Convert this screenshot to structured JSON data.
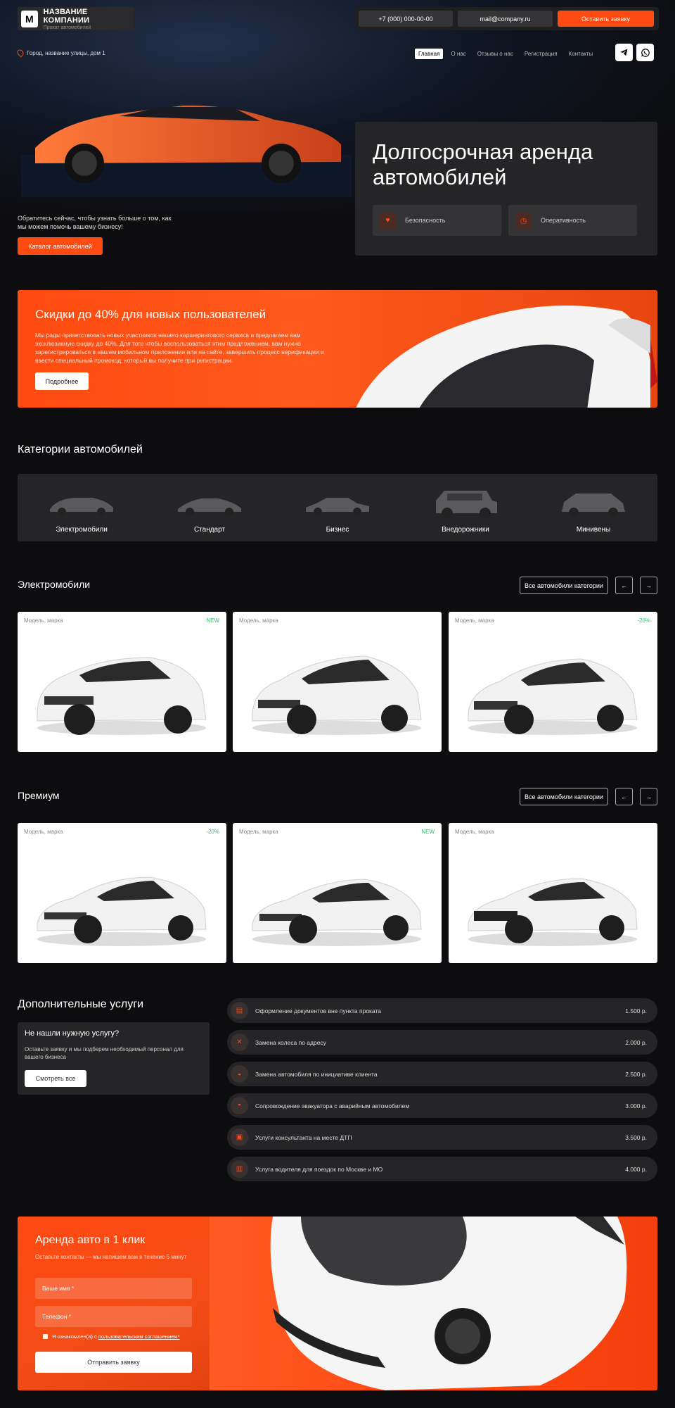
{
  "header": {
    "logo_icon": "M",
    "company_name": "НАЗВАНИЕ КОМПАНИИ",
    "company_sub": "Прокат автомобилей",
    "phone": "+7 (000) 000-00-00",
    "email": "mail@company.ru",
    "order_button": "Оставить заявку",
    "address": "Город, название улицы, дом 1",
    "nav": [
      "Главная",
      "О нас",
      "Отзывы о нас",
      "Регистрация",
      "Контакты"
    ],
    "socials": [
      "telegram-icon",
      "whatsapp-icon"
    ]
  },
  "hero": {
    "intro": "Обратитесь сейчас, чтобы узнать больше о том, как мы можем помочь вашему бизнесу!",
    "catalog_button": "Каталог автомобилей",
    "title": "Долгосрочная аренда автомобилей",
    "features": [
      {
        "icon": "heart-shield-icon",
        "label": "Безопасность"
      },
      {
        "icon": "clock-icon",
        "label": "Оперативность"
      }
    ]
  },
  "promo": {
    "title": "Скидки до 40% для новых пользователей",
    "text": "Мы рады приветствовать новых участников нашего каршерингового сервиса и предлагаем вам эксклюзивную скидку до 40%. Для того чтобы воспользоваться этим предложением, вам нужно зарегистрироваться в нашем мобильном приложении или на сайте, завершить процесс верификации и ввести специальный промокод, который вы получите при регистрации.",
    "button": "Подробнее"
  },
  "categories": {
    "title": "Категории автомобилей",
    "items": [
      "Электромобили",
      "Стандарт",
      "Бизнес",
      "Внедорожники",
      "Минивены"
    ]
  },
  "sliders": [
    {
      "title": "Электромобили",
      "all_button": "Все автомобили категории",
      "prev": "←",
      "next": "→",
      "cards": [
        {
          "model": "Модель, марка",
          "badge": "NEW"
        },
        {
          "model": "Модель, марка",
          "badge": ""
        },
        {
          "model": "Модель, марка",
          "badge": "-20%"
        }
      ]
    },
    {
      "title": "Премиум",
      "all_button": "Все автомобили категории",
      "prev": "←",
      "next": "→",
      "cards": [
        {
          "model": "Модель, марка",
          "badge": "-20%"
        },
        {
          "model": "Модель, марка",
          "badge": "NEW"
        },
        {
          "model": "Модель, марка",
          "badge": ""
        }
      ]
    }
  ],
  "services": {
    "title": "Дополнительные услуги",
    "help_title": "Не нашли нужную услугу?",
    "help_text": "Оставьте заявку и мы подберем необходимый персонал для вашего бизнеса",
    "help_button": "Смотреть все",
    "items": [
      {
        "icon": "document-icon",
        "name": "Оформление документов вне пункта проката",
        "price": "1.500 р."
      },
      {
        "icon": "wrench-icon",
        "name": "Замена колеса по адресу",
        "price": "2.000 р."
      },
      {
        "icon": "car-icon",
        "name": "Замена автомобиля по инициативе клиента",
        "price": "2.500 р."
      },
      {
        "icon": "tow-truck-icon",
        "name": "Сопровождение эвакуатора с аварийным автомобилем",
        "price": "3.000 р."
      },
      {
        "icon": "consultant-icon",
        "name": "Услуги консультанта на месте ДТП",
        "price": "3.500 р."
      },
      {
        "icon": "driver-icon",
        "name": "Услуга водителя для поездок по Москве и МО",
        "price": "4.000 р."
      }
    ]
  },
  "form": {
    "title": "Аренда авто в 1 клик",
    "subtitle": "Оставьте контакты — мы напишем вам в течение 5 минут",
    "name_placeholder": "Ваше имя *",
    "phone_placeholder": "Телефон *",
    "consent_prefix": "Я ознакомлен(а) с ",
    "consent_link": "пользовательским соглашением*",
    "submit": "Отправить заявку"
  },
  "colors": {
    "accent": "#ff4a12",
    "bg": "#0d0d0f",
    "panel": "#252527",
    "badge_green": "#35c26b"
  }
}
